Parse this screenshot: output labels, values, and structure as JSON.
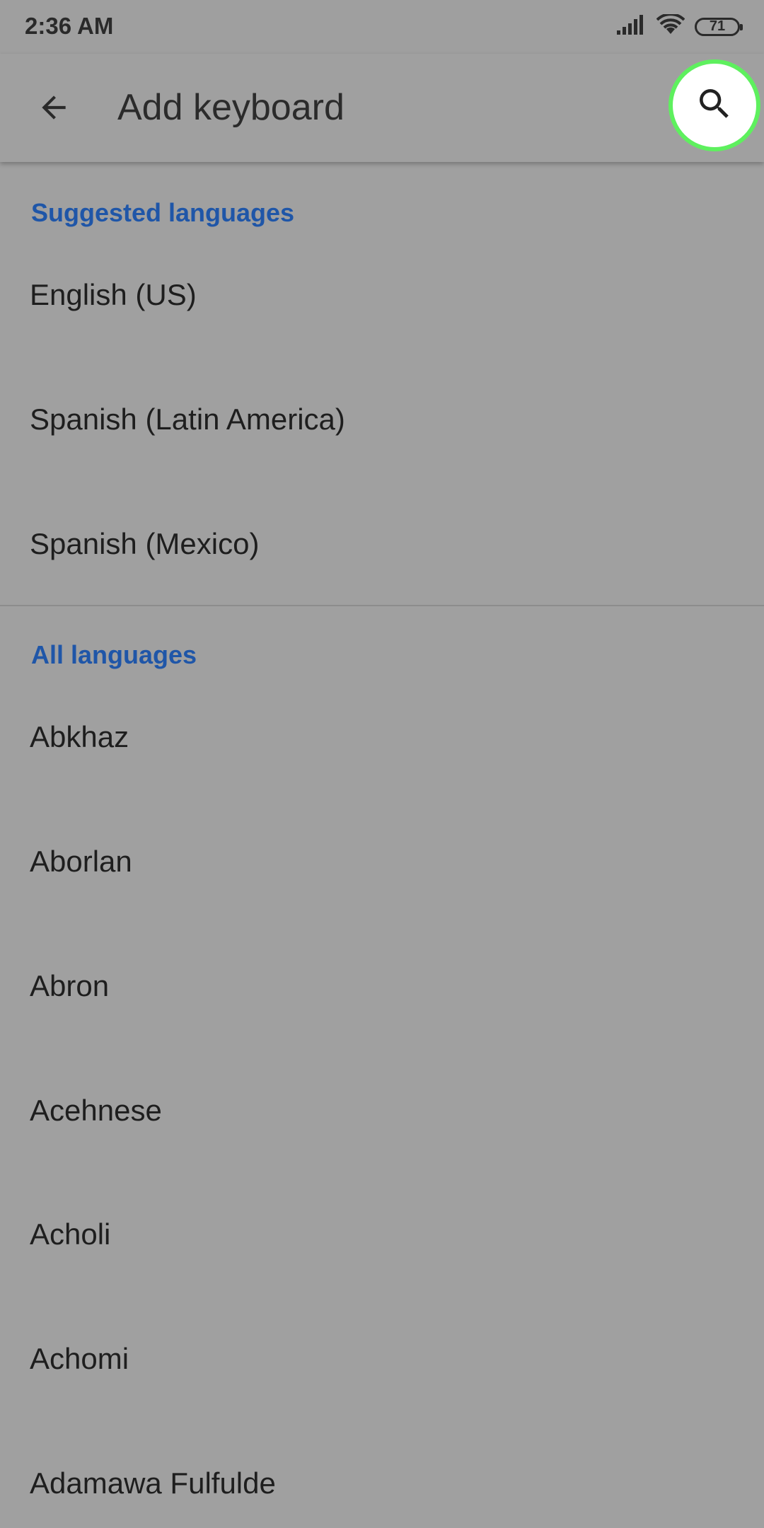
{
  "status_bar": {
    "time": "2:36 AM",
    "battery": "71"
  },
  "app_bar": {
    "title": "Add keyboard"
  },
  "suggested": {
    "header": "Suggested languages",
    "items": [
      "English (US)",
      "Spanish (Latin America)",
      "Spanish (Mexico)"
    ]
  },
  "all": {
    "header": "All languages",
    "items": [
      "Abkhaz",
      "Aborlan",
      "Abron",
      "Acehnese",
      "Acholi",
      "Achomi",
      "Adamawa Fulfulde"
    ]
  },
  "colors": {
    "accent": "#1f56a8",
    "highlight": "#5ef05e",
    "background": "#a0a0a0"
  },
  "icons": {
    "back": "arrow-left-icon",
    "search": "search-icon",
    "signal": "signal-icon",
    "wifi": "wifi-icon",
    "battery": "battery-icon"
  }
}
